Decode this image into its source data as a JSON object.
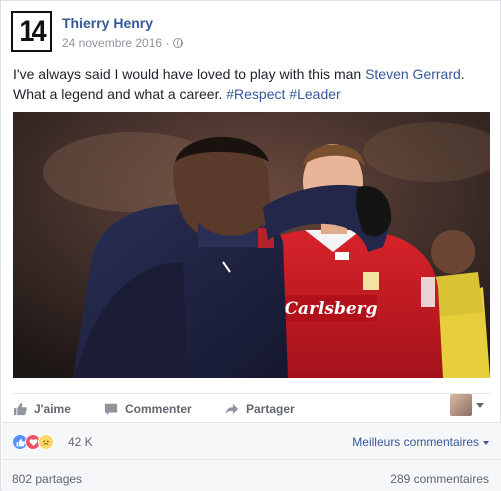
{
  "post": {
    "author": "Thierry Henry",
    "avatar_text": "14",
    "date": "24 novembre 2016 · ",
    "text_plain": "I've always said I would have loved to play with this man ",
    "mention": "Steven Gerrard",
    "text_plain2": ". What a legend and what a career. ",
    "hashtag1": "#Respect",
    "hashtag2": "#Leader",
    "jersey_text": "Carlsberg"
  },
  "actions": {
    "like": "J'aime",
    "comment": "Commenter",
    "share": "Partager"
  },
  "reactions": {
    "count": "42 K",
    "sort_label": "Meilleurs commentaires"
  },
  "stats": {
    "shares": "802 partages",
    "comments": "289 commentaires"
  },
  "colors": {
    "link": "#365899",
    "like_blue": "#5890ff",
    "love_red": "#f25268"
  },
  "icons": [
    "globe-icon",
    "like-icon",
    "comment-icon",
    "share-icon",
    "chevron-down-icon"
  ]
}
